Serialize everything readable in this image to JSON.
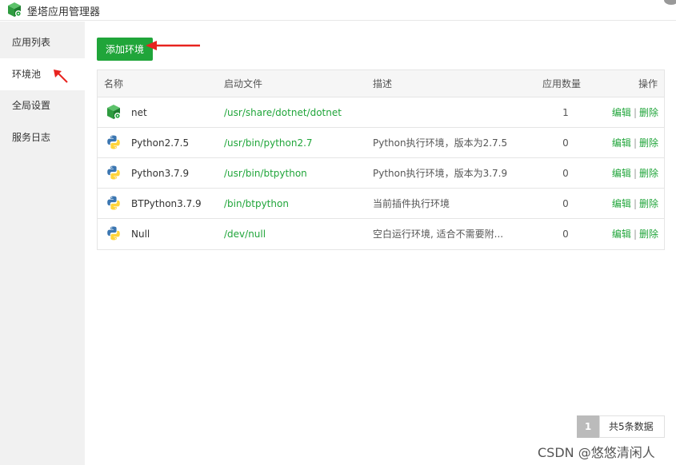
{
  "app": {
    "title": "堡塔应用管理器",
    "logo_icon": "green-cube-gear-icon",
    "accent": "#20a53a"
  },
  "sidebar": {
    "items": [
      {
        "label": "应用列表",
        "active": false
      },
      {
        "label": "环境池",
        "active": true
      },
      {
        "label": "全局设置",
        "active": false
      },
      {
        "label": "服务日志",
        "active": false
      }
    ]
  },
  "toolbar": {
    "add_label": "添加环境"
  },
  "table": {
    "headers": {
      "name": "名称",
      "path": "启动文件",
      "desc": "描述",
      "count": "应用数量",
      "ops": "操作"
    },
    "rows": [
      {
        "icon": "dotnet-cube-icon",
        "name": "net",
        "path": "/usr/share/dotnet/dotnet",
        "desc": "",
        "count": "1",
        "edit": "编辑",
        "sep": "|",
        "delete": "删除"
      },
      {
        "icon": "python-icon",
        "name": "Python2.7.5",
        "path": "/usr/bin/python2.7",
        "desc": "Python执行环境，版本为2.7.5",
        "count": "0",
        "edit": "编辑",
        "sep": "|",
        "delete": "删除"
      },
      {
        "icon": "python-icon",
        "name": "Python3.7.9",
        "path": "/usr/bin/btpython",
        "desc": "Python执行环境，版本为3.7.9",
        "count": "0",
        "edit": "编辑",
        "sep": "|",
        "delete": "删除"
      },
      {
        "icon": "python-icon",
        "name": "BTPython3.7.9",
        "path": "/bin/btpython",
        "desc": "当前插件执行环境",
        "count": "0",
        "edit": "编辑",
        "sep": "|",
        "delete": "删除"
      },
      {
        "icon": "python-icon",
        "name": "Null",
        "path": "/dev/null",
        "desc": "空白运行环境, 适合不需要附...",
        "count": "0",
        "edit": "编辑",
        "sep": "|",
        "delete": "删除"
      }
    ]
  },
  "pagination": {
    "current": "1",
    "total_text": "共5条数据"
  },
  "watermark": "CSDN @悠悠清闲人"
}
